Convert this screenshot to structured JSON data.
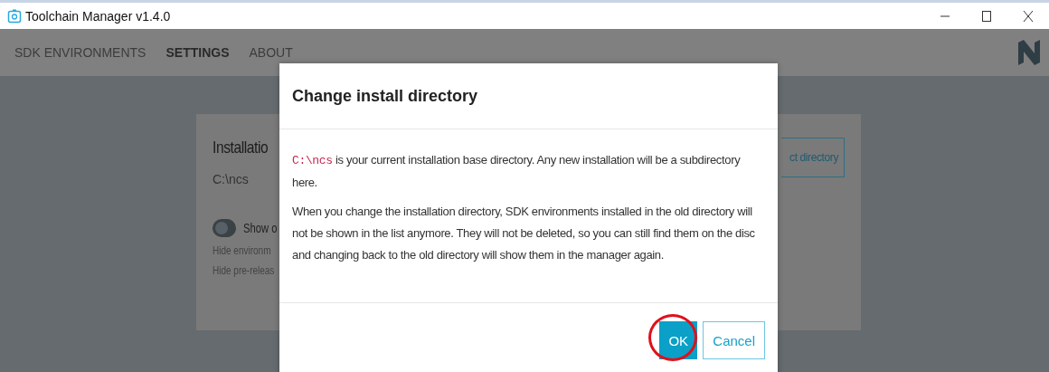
{
  "window": {
    "title": "Toolchain Manager v1.4.0"
  },
  "tabs": [
    {
      "label": "SDK ENVIRONMENTS",
      "selected": false
    },
    {
      "label": "SETTINGS",
      "selected": true
    },
    {
      "label": "ABOUT",
      "selected": false
    }
  ],
  "settings_card": {
    "title": "Installatio",
    "path": "C:\\ncs",
    "toggle": {
      "label": "Show o",
      "on": false
    },
    "hints": [
      "Hide environm",
      "Hide pre-releas"
    ],
    "button": "ct directory"
  },
  "dialog": {
    "title": "Change install directory",
    "paragraphs": [
      {
        "code": "C:\\ncs",
        "text": " is your current installation base directory. Any new installation will be a subdirectory here."
      },
      {
        "text": "When you change the installation directory, SDK environments installed in the old directory will not be shown in the list anymore. They will not be deleted, so you can still find them on the disc and changing back to the old directory will show them in the manager again."
      }
    ],
    "buttons": [
      {
        "label": "OK",
        "kind": "primary",
        "circled": true
      },
      {
        "label": "Cancel",
        "kind": "secondary",
        "circled": false
      }
    ]
  }
}
